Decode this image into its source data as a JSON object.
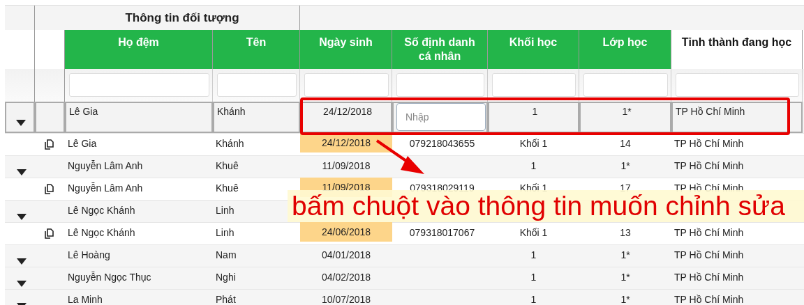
{
  "group_header": "Thông tin đối tượng",
  "columns": [
    {
      "label": "Họ đệm",
      "kind": "green"
    },
    {
      "label": "Tên",
      "kind": "green"
    },
    {
      "label": "Ngày sinh",
      "kind": "green"
    },
    {
      "label": "Số định danh cá nhân",
      "kind": "green"
    },
    {
      "label": "Khối học",
      "kind": "green"
    },
    {
      "label": "Lớp học",
      "kind": "green"
    },
    {
      "label": "Tỉnh thành đang học",
      "kind": "plain"
    }
  ],
  "rows": [
    {
      "kind": "editing",
      "first": "Lê Gia",
      "last": "Khánh",
      "dob": "24/12/2018",
      "dob_highlighted": false,
      "id_placeholder": "Nhập",
      "grade": "1",
      "class": "1*",
      "province": "TP Hồ Chí Minh"
    },
    {
      "kind": "copy",
      "first": "Lê Gia",
      "last": "Khánh",
      "dob": "24/12/2018",
      "dob_highlighted": true,
      "id": "079218043655",
      "grade": "Khối 1",
      "class": "14",
      "province": "TP Hồ Chí Minh"
    },
    {
      "kind": "parent",
      "first": "Nguyễn Lâm Anh",
      "last": "Khuê",
      "dob": "11/09/2018",
      "dob_highlighted": false,
      "grade": "1",
      "class": "1*",
      "province": "TP Hồ Chí Minh"
    },
    {
      "kind": "copy",
      "first": "Nguyễn Lâm Anh",
      "last": "Khuê",
      "dob": "11/09/2018",
      "dob_highlighted": true,
      "id": "079318029119",
      "grade": "Khối 1",
      "class": "17",
      "province": "TP Hồ Chí Minh"
    },
    {
      "kind": "parent",
      "first": "Lê Ngọc Khánh",
      "last": "Linh"
    },
    {
      "kind": "copy",
      "first": "Lê Ngọc Khánh",
      "last": "Linh",
      "dob": "24/06/2018",
      "dob_highlighted": true,
      "id": "079318017067",
      "grade": "Khối 1",
      "class": "13",
      "province": "TP Hồ Chí Minh"
    },
    {
      "kind": "parent",
      "first": "Lê Hoàng",
      "last": "Nam",
      "dob": "04/01/2018",
      "dob_highlighted": false,
      "grade": "1",
      "class": "1*",
      "province": "TP Hồ Chí Minh"
    },
    {
      "kind": "parent",
      "first": "Nguyễn Ngọc Thục",
      "last": "Nghi",
      "dob": "04/02/2018",
      "dob_highlighted": false,
      "grade": "1",
      "class": "1*",
      "province": "TP Hồ Chí Minh"
    },
    {
      "kind": "parent",
      "first": "La Minh",
      "last": "Phát",
      "dob": "10/07/2018",
      "dob_highlighted": false,
      "grade": "1",
      "class": "1*",
      "province": "TP Hồ Chí Minh"
    }
  ],
  "annotation": {
    "text": "bấm chuột vào thông tin muốn chỉnh sửa"
  }
}
